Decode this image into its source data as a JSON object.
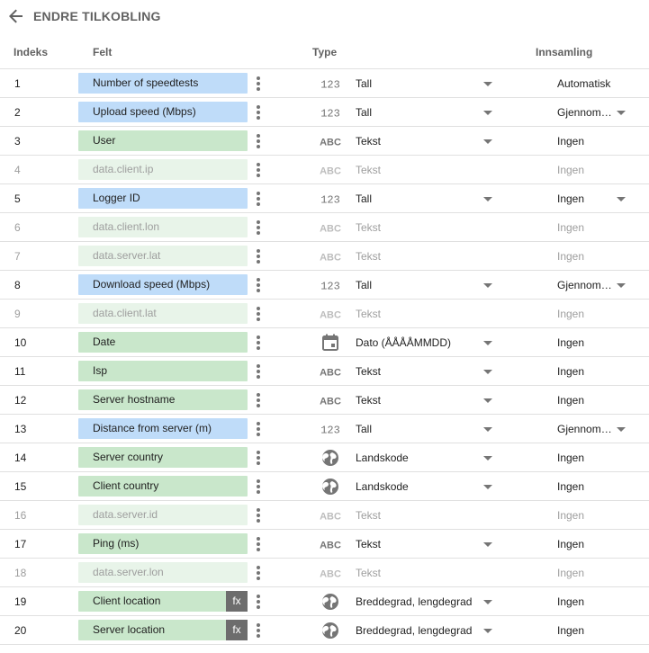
{
  "window": {
    "title": "ENDRE TILKOBLING"
  },
  "colors": {
    "metric": "#bfdcf9",
    "dimension": "#c9e7cb",
    "disabled": "#e8f4e9",
    "fx": "#6d6d6d"
  },
  "columns": {
    "index": "Indeks",
    "field": "Felt",
    "type": "Type",
    "aggregation": "Innsamling"
  },
  "rows": [
    {
      "index": "1",
      "field": "Number of speedtests",
      "kind": "metric",
      "disabled": false,
      "fx": false,
      "type_icon": "number-123-icon",
      "type": "Tall",
      "type_dropdown": true,
      "aggregation": "Automatisk",
      "agg_dropdown": false
    },
    {
      "index": "2",
      "field": "Upload speed (Mbps)",
      "kind": "metric",
      "disabled": false,
      "fx": false,
      "type_icon": "number-123-icon",
      "type": "Tall",
      "type_dropdown": true,
      "aggregation": "Gjennom…",
      "agg_dropdown": true
    },
    {
      "index": "3",
      "field": "User",
      "kind": "dimension",
      "disabled": false,
      "fx": false,
      "type_icon": "text-abc-icon",
      "type": "Tekst",
      "type_dropdown": true,
      "aggregation": "Ingen",
      "agg_dropdown": false
    },
    {
      "index": "4",
      "field": "data.client.ip",
      "kind": "dimension",
      "disabled": true,
      "fx": false,
      "type_icon": "text-abc-icon",
      "type": "Tekst",
      "type_dropdown": false,
      "aggregation": "Ingen",
      "agg_dropdown": false
    },
    {
      "index": "5",
      "field": "Logger ID",
      "kind": "metric",
      "disabled": false,
      "fx": false,
      "type_icon": "number-123-icon",
      "type": "Tall",
      "type_dropdown": true,
      "aggregation": "Ingen",
      "agg_dropdown": true
    },
    {
      "index": "6",
      "field": "data.client.lon",
      "kind": "dimension",
      "disabled": true,
      "fx": false,
      "type_icon": "text-abc-icon",
      "type": "Tekst",
      "type_dropdown": false,
      "aggregation": "Ingen",
      "agg_dropdown": false
    },
    {
      "index": "7",
      "field": "data.server.lat",
      "kind": "dimension",
      "disabled": true,
      "fx": false,
      "type_icon": "text-abc-icon",
      "type": "Tekst",
      "type_dropdown": false,
      "aggregation": "Ingen",
      "agg_dropdown": false
    },
    {
      "index": "8",
      "field": "Download speed (Mbps)",
      "kind": "metric",
      "disabled": false,
      "fx": false,
      "type_icon": "number-123-icon",
      "type": "Tall",
      "type_dropdown": true,
      "aggregation": "Gjennom…",
      "agg_dropdown": true
    },
    {
      "index": "9",
      "field": "data.client.lat",
      "kind": "dimension",
      "disabled": true,
      "fx": false,
      "type_icon": "text-abc-icon",
      "type": "Tekst",
      "type_dropdown": false,
      "aggregation": "Ingen",
      "agg_dropdown": false
    },
    {
      "index": "10",
      "field": "Date",
      "kind": "dimension",
      "disabled": false,
      "fx": false,
      "type_icon": "calendar-icon",
      "type": "Dato (ÅÅÅÅMMDD)",
      "type_dropdown": true,
      "aggregation": "Ingen",
      "agg_dropdown": false
    },
    {
      "index": "11",
      "field": "Isp",
      "kind": "dimension",
      "disabled": false,
      "fx": false,
      "type_icon": "text-abc-icon",
      "type": "Tekst",
      "type_dropdown": true,
      "aggregation": "Ingen",
      "agg_dropdown": false
    },
    {
      "index": "12",
      "field": "Server hostname",
      "kind": "dimension",
      "disabled": false,
      "fx": false,
      "type_icon": "text-abc-icon",
      "type": "Tekst",
      "type_dropdown": true,
      "aggregation": "Ingen",
      "agg_dropdown": false
    },
    {
      "index": "13",
      "field": "Distance from server (m)",
      "kind": "metric",
      "disabled": false,
      "fx": false,
      "type_icon": "number-123-icon",
      "type": "Tall",
      "type_dropdown": true,
      "aggregation": "Gjennom…",
      "agg_dropdown": true
    },
    {
      "index": "14",
      "field": "Server country",
      "kind": "dimension",
      "disabled": false,
      "fx": false,
      "type_icon": "globe-icon",
      "type": "Landskode",
      "type_dropdown": true,
      "aggregation": "Ingen",
      "agg_dropdown": false
    },
    {
      "index": "15",
      "field": "Client country",
      "kind": "dimension",
      "disabled": false,
      "fx": false,
      "type_icon": "globe-icon",
      "type": "Landskode",
      "type_dropdown": true,
      "aggregation": "Ingen",
      "agg_dropdown": false
    },
    {
      "index": "16",
      "field": "data.server.id",
      "kind": "dimension",
      "disabled": true,
      "fx": false,
      "type_icon": "text-abc-icon",
      "type": "Tekst",
      "type_dropdown": false,
      "aggregation": "Ingen",
      "agg_dropdown": false
    },
    {
      "index": "17",
      "field": "Ping (ms)",
      "kind": "dimension",
      "disabled": false,
      "fx": false,
      "type_icon": "text-abc-icon",
      "type": "Tekst",
      "type_dropdown": true,
      "aggregation": "Ingen",
      "agg_dropdown": false
    },
    {
      "index": "18",
      "field": "data.server.lon",
      "kind": "dimension",
      "disabled": true,
      "fx": false,
      "type_icon": "text-abc-icon",
      "type": "Tekst",
      "type_dropdown": false,
      "aggregation": "Ingen",
      "agg_dropdown": false
    },
    {
      "index": "19",
      "field": "Client location",
      "kind": "dimension",
      "disabled": false,
      "fx": true,
      "type_icon": "globe-icon",
      "type": "Breddegrad, lengdegrad",
      "type_dropdown": true,
      "aggregation": "Ingen",
      "agg_dropdown": false
    },
    {
      "index": "20",
      "field": "Server location",
      "kind": "dimension",
      "disabled": false,
      "fx": true,
      "type_icon": "globe-icon",
      "type": "Breddegrad, lengdegrad",
      "type_dropdown": true,
      "aggregation": "Ingen",
      "agg_dropdown": false
    }
  ],
  "fx_label": "fx",
  "icon_text": {
    "number": "123",
    "text": "ABC"
  }
}
